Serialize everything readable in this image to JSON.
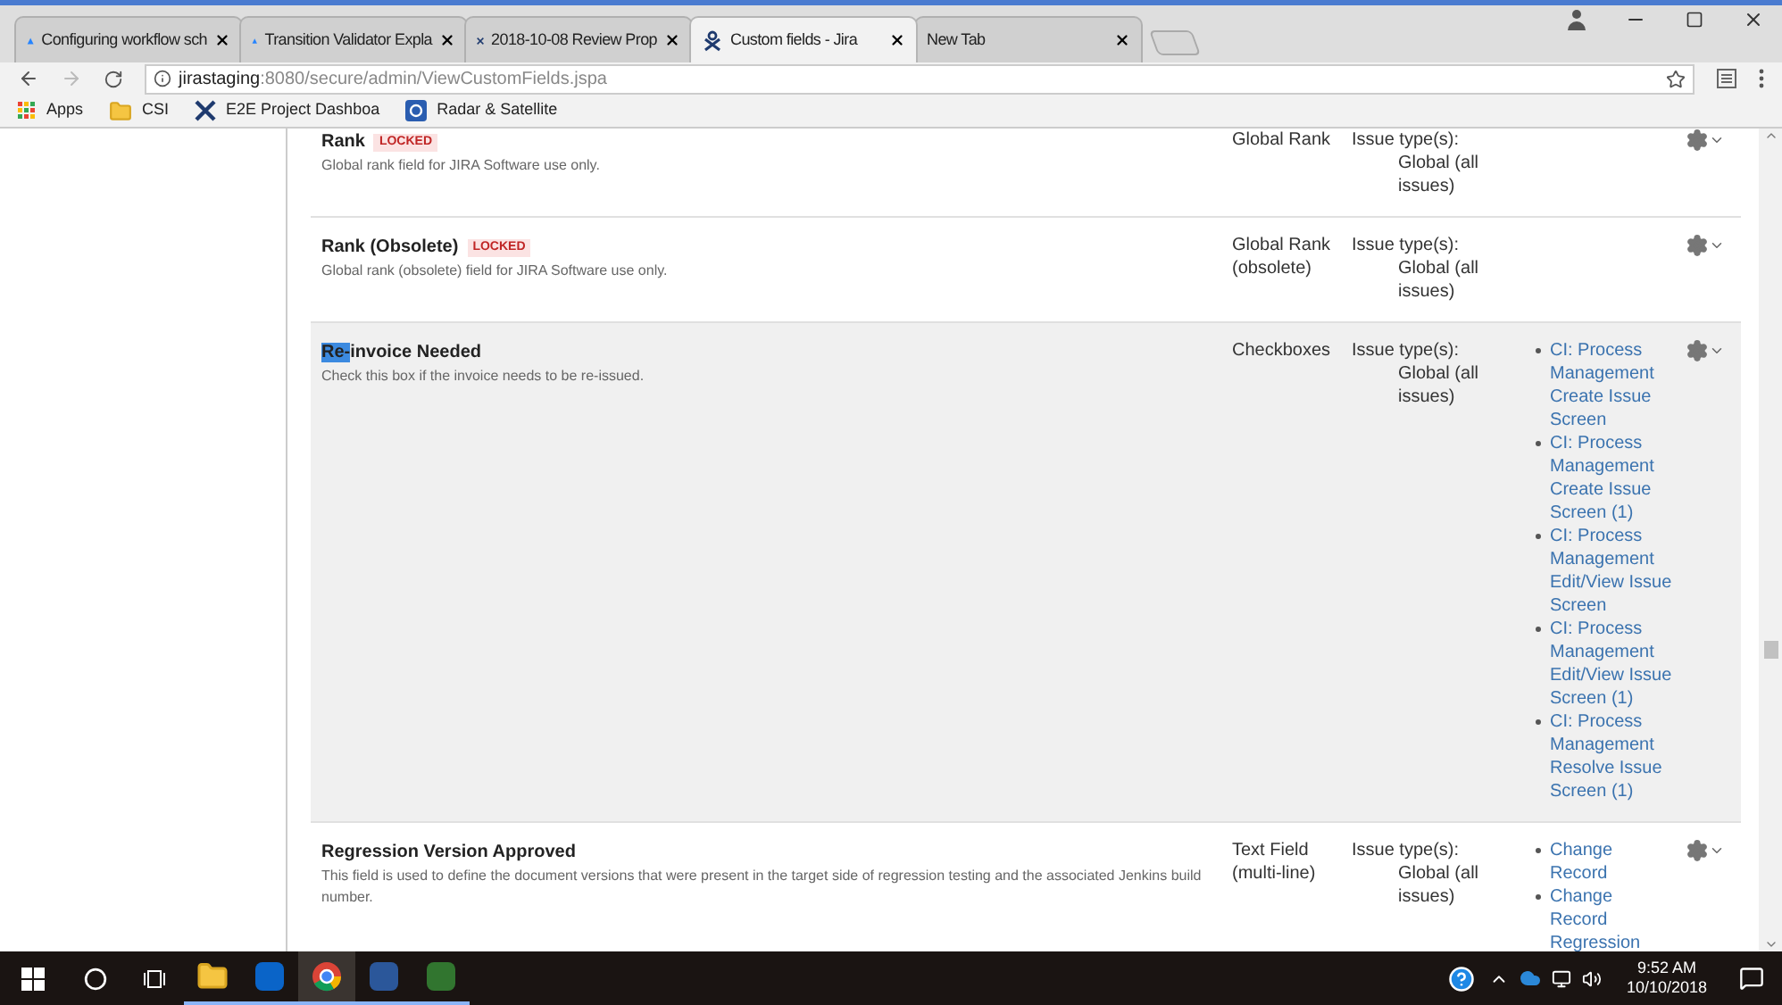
{
  "browser_tabs": [
    {
      "title": "Configuring workflow sch",
      "kind": "atlassian",
      "selected": false
    },
    {
      "title": "Transition Validator Expla",
      "kind": "atlassian",
      "selected": false
    },
    {
      "title": "2018-10-08 Review Prop",
      "kind": "cross",
      "selected": false
    },
    {
      "title": "Custom fields - Jira",
      "kind": "jira",
      "selected": true
    },
    {
      "title": "New Tab",
      "kind": "none",
      "selected": false
    }
  ],
  "address_bar": {
    "host": "jirastaging",
    "path": ":8080/secure/admin/ViewCustomFields.jspa"
  },
  "bookmarks": [
    {
      "label": "Apps",
      "kind": "apps"
    },
    {
      "label": "CSI",
      "kind": "folder"
    },
    {
      "label": "E2E Project Dashboa",
      "kind": "cross"
    },
    {
      "label": "Radar & Satellite",
      "kind": "radar"
    }
  ],
  "fields": [
    {
      "name_parts": [
        {
          "text": "Rank",
          "selected": false
        }
      ],
      "locked_badge": "LOCKED",
      "description": "Global rank field for JIRA Software use only.",
      "type": "Global Rank",
      "context_label": "Issue type(s):",
      "context_value": "Global (all issues)",
      "selected": false
    },
    {
      "name_parts": [
        {
          "text": "Rank (Obsolete)",
          "selected": false
        }
      ],
      "locked_badge": "LOCKED",
      "description": "Global rank (obsolete) field for JIRA Software use only.",
      "type": "Global Rank (obsolete)",
      "context_label": "Issue type(s):",
      "context_value": "Global (all issues)",
      "selected": false
    },
    {
      "name_parts": [
        {
          "text": "Re-",
          "selected": true
        },
        {
          "text": "invoice Needed",
          "selected": false
        }
      ],
      "description": "Check this box if the invoice needs to be re-issued.",
      "type": "Checkboxes",
      "context_label": "Issue type(s):",
      "context_value": "Global (all issues)",
      "screens": [
        "CI: Process Management Create Issue Screen",
        "CI: Process Management Create Issue Screen (1)",
        "CI: Process Management Edit/View Issue Screen",
        "CI: Process Management Edit/View Issue Screen (1)",
        "CI: Process Management Resolve Issue Screen (1)"
      ],
      "selected": true
    },
    {
      "name_parts": [
        {
          "text": "Regression Version Approved",
          "selected": false
        }
      ],
      "description": "This field is used to define the document versions that were present in the target side of regression testing and the associated Jenkins build number.",
      "type": "Text Field (multi-line)",
      "context_label": "Issue type(s):",
      "context_value": "Global (all issues)",
      "screens": [
        "Change Record",
        "Change Record Regression"
      ],
      "selected": false
    }
  ],
  "taskbar": {
    "apps": [
      {
        "kind": "explorer",
        "selected": false
      },
      {
        "kind": "outlook",
        "selected": false
      },
      {
        "kind": "chrome",
        "selected": true
      },
      {
        "kind": "word",
        "selected": false
      },
      {
        "kind": "project",
        "selected": false
      }
    ],
    "time": "9:52 AM",
    "date": "10/10/2018"
  }
}
